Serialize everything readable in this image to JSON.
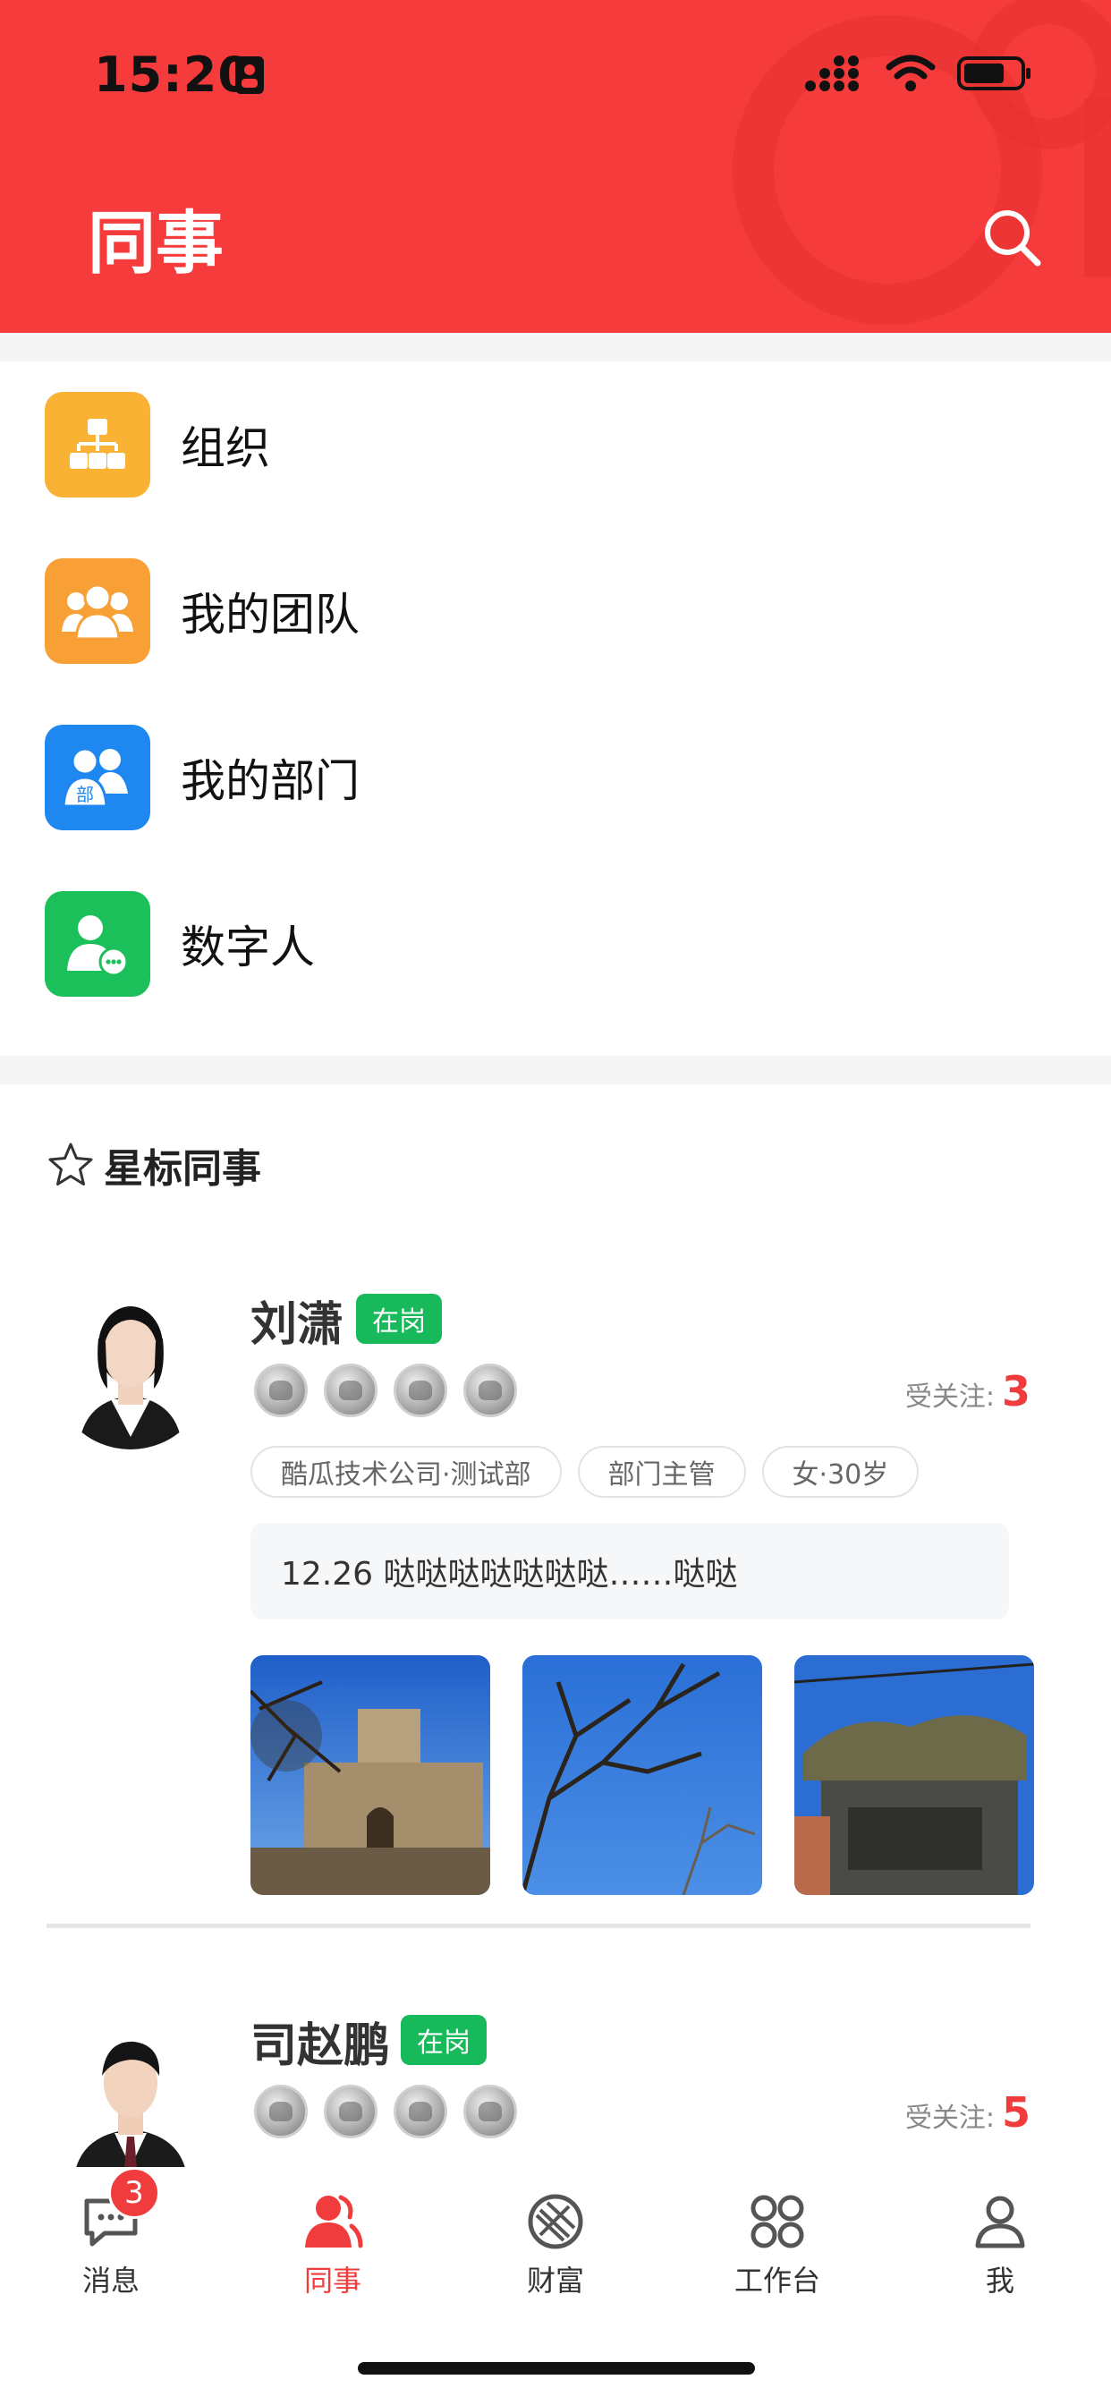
{
  "status_bar": {
    "time": "15:20"
  },
  "header": {
    "title": "同事"
  },
  "menu": {
    "items": [
      {
        "label": "组织",
        "icon": "org-chart-icon",
        "color": "#f9b233"
      },
      {
        "label": "我的团队",
        "icon": "team-icon",
        "color": "#f8a035"
      },
      {
        "label": "我的部门",
        "icon": "department-icon",
        "color": "#1e88f0",
        "icon_text": "部"
      },
      {
        "label": "数字人",
        "icon": "digital-human-icon",
        "color": "#1cc05a"
      }
    ]
  },
  "starred": {
    "title": "星标同事",
    "follow_label": "受关注:",
    "colleagues": [
      {
        "name": "刘潇",
        "status": "在岗",
        "followers": "3",
        "tags": [
          "酷瓜技术公司·测试部",
          "部门主管",
          "女·30岁"
        ],
        "post": "12.26 哒哒哒哒哒哒哒……哒哒"
      },
      {
        "name": "司赵鹏",
        "status": "在岗",
        "followers": "5"
      }
    ]
  },
  "tabbar": {
    "items": [
      {
        "label": "消息",
        "icon": "message-icon",
        "badge": "3"
      },
      {
        "label": "同事",
        "icon": "colleagues-icon",
        "active": true
      },
      {
        "label": "财富",
        "icon": "wealth-icon"
      },
      {
        "label": "工作台",
        "icon": "workbench-icon"
      },
      {
        "label": "我",
        "icon": "profile-icon"
      }
    ]
  },
  "colors": {
    "brand": "#f53b3b",
    "status_green": "#18b95a",
    "follow_red": "#f03c3c"
  }
}
